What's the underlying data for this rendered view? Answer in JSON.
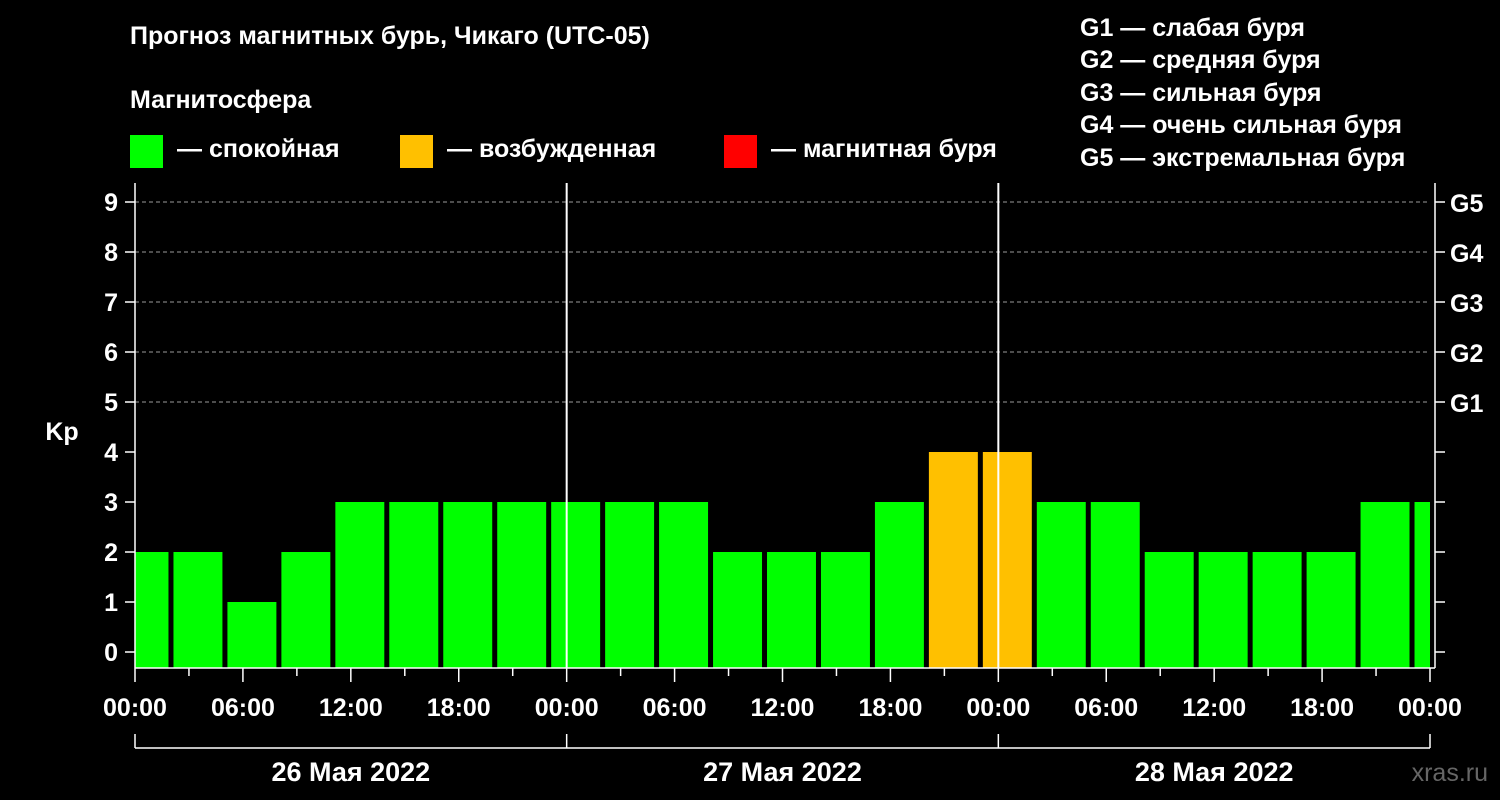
{
  "title": "Прогноз магнитных бурь, Чикаго (UTC-05)",
  "subtitle": "Магнитосфера",
  "legend": [
    {
      "label": "— спокойная",
      "color": "#00ff00"
    },
    {
      "label": "— возбужденная",
      "color": "#ffc000"
    },
    {
      "label": "— магнитная буря",
      "color": "#ff0000"
    }
  ],
  "g_scale": [
    "G1 — слабая буря",
    "G2 — средняя буря",
    "G3 — сильная буря",
    "G4 — очень сильная буря",
    "G5 — экстремальная буря"
  ],
  "brand": "xras.ru",
  "chart_data": {
    "type": "bar",
    "ylabel": "Kp",
    "ylim": [
      0,
      9
    ],
    "yticks": [
      0,
      1,
      2,
      3,
      4,
      5,
      6,
      7,
      8,
      9
    ],
    "right_ticks": [
      {
        "value": 5,
        "label": "G1"
      },
      {
        "value": 6,
        "label": "G2"
      },
      {
        "value": 7,
        "label": "G3"
      },
      {
        "value": 8,
        "label": "G4"
      },
      {
        "value": 9,
        "label": "G5"
      }
    ],
    "x_tick_labels": [
      "00:00",
      "06:00",
      "12:00",
      "18:00",
      "00:00",
      "06:00",
      "12:00",
      "18:00",
      "00:00",
      "06:00",
      "12:00",
      "18:00",
      "00:00"
    ],
    "days": [
      "26 Мая 2022",
      "27 Мая 2022",
      "28 Мая 2022"
    ],
    "interval_hours": 3,
    "first_bar_offset_hours": -1,
    "values": [
      2,
      2,
      1,
      2,
      3,
      3,
      3,
      3,
      3,
      3,
      3,
      2,
      2,
      2,
      3,
      4,
      4,
      3,
      3,
      2,
      2,
      2,
      2,
      3,
      3
    ],
    "thresholds": {
      "quiet_max": 3,
      "active_max": 4
    },
    "grid": true
  }
}
